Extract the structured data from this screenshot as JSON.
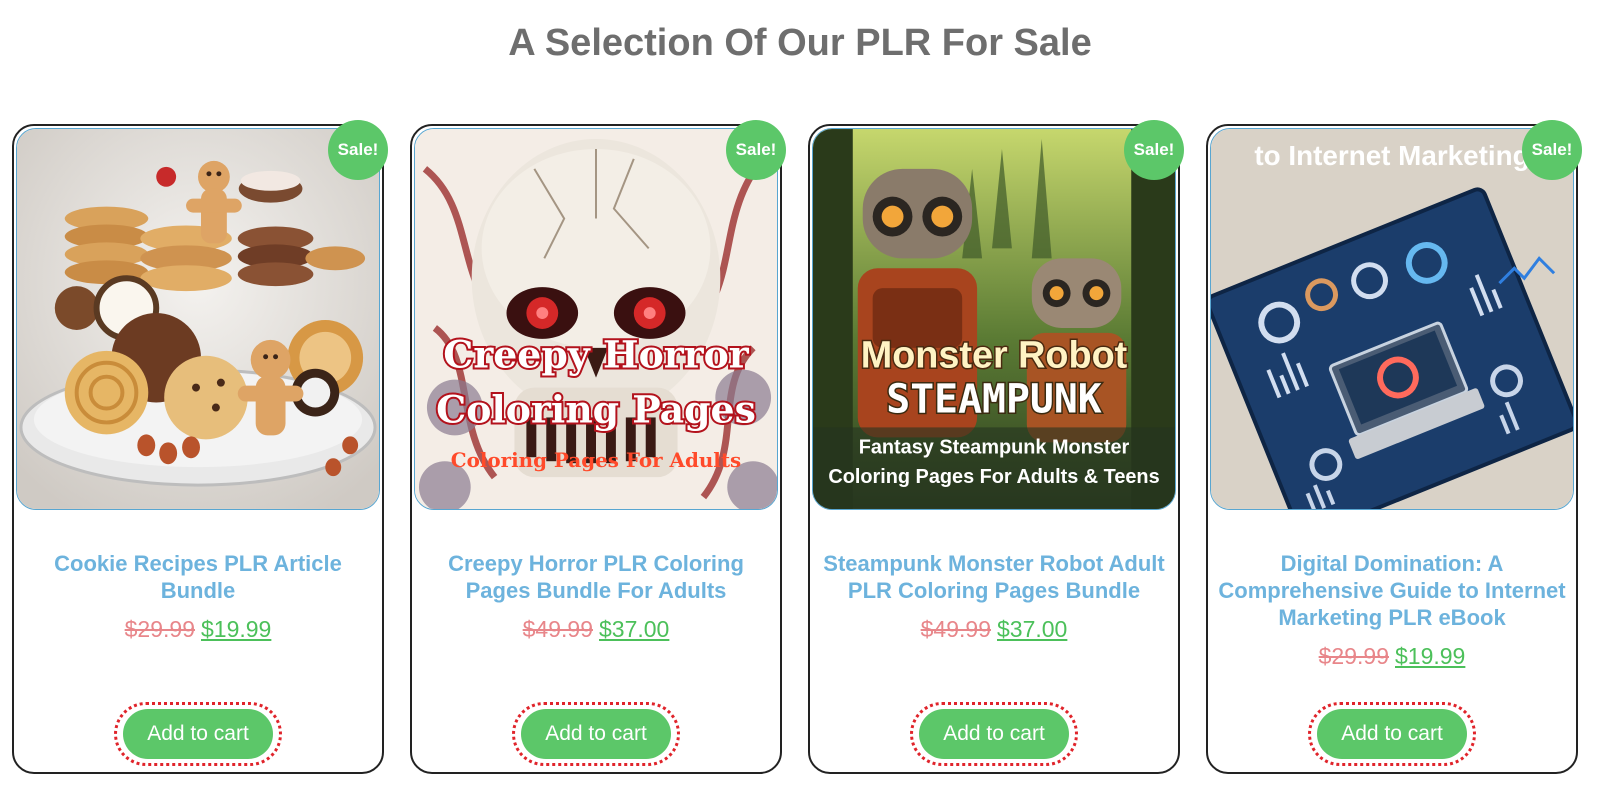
{
  "page": {
    "section_title": "A Selection Of Our PLR For Sale"
  },
  "products": [
    {
      "title": "Cookie Recipes PLR Article Bundle",
      "old_price": "$29.99",
      "new_price": "$19.99",
      "badge": "Sale!",
      "cart_label": "Add to cart",
      "image_alt": "cookies"
    },
    {
      "title": "Creepy Horror PLR Coloring Pages Bundle For Adults",
      "old_price": "$49.99",
      "new_price": "$37.00",
      "badge": "Sale!",
      "cart_label": "Add to cart",
      "image_alt": "skull",
      "cover": {
        "line1": "Creepy Horror",
        "line2": "Coloring Pages",
        "line3": "Coloring Pages For Adults"
      }
    },
    {
      "title": "Steampunk Monster Robot Adult PLR Coloring Pages Bundle",
      "old_price": "$49.99",
      "new_price": "$37.00",
      "badge": "Sale!",
      "cart_label": "Add to cart",
      "image_alt": "robots",
      "cover": {
        "line1": "Monster Robot",
        "line2": "STEAMPUNK",
        "line3": "Fantasy Steampunk Monster",
        "line4": "Coloring Pages For Adults & Teens"
      }
    },
    {
      "title": "Digital Domination: A Comprehensive Guide to Internet Marketing PLR eBook",
      "old_price": "$29.99",
      "new_price": "$19.99",
      "badge": "Sale!",
      "cart_label": "Add to cart",
      "image_alt": "ebook",
      "cover": {
        "line1": "to Internet Marketing"
      }
    }
  ],
  "colors": {
    "badge_green": "#5cc769",
    "title_blue": "#6db3dd",
    "old_price_red": "#e8868a",
    "new_price_green": "#4cc05a",
    "focus_red": "#e0242b"
  }
}
